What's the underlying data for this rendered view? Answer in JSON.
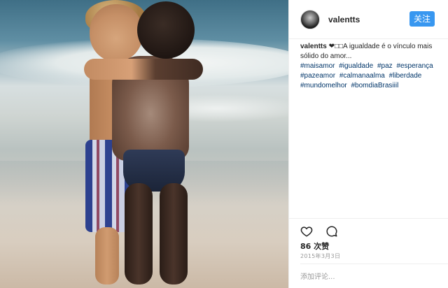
{
  "post": {
    "username": "valentts",
    "follow_label": "关注",
    "caption_user": "valentts",
    "caption_text": "❤□□A igualdade é o vínculo mais sólido do amor...",
    "hashtags": [
      "#maisamor",
      "#igualdade",
      "#paz",
      "#esperança",
      "#pazeamor",
      "#calmanaalma",
      "#liberdade",
      "#mundomelhor",
      "#bomdiaBrasiiil"
    ],
    "likes": "86 次赞",
    "date": "2015年3月3日",
    "comment_placeholder": "添加评论..."
  },
  "icons": {
    "like": "heart-icon",
    "comment": "comment-icon"
  },
  "colors": {
    "follow_button": "#3897f0",
    "hashtag": "#003569",
    "muted_text": "#999999"
  }
}
